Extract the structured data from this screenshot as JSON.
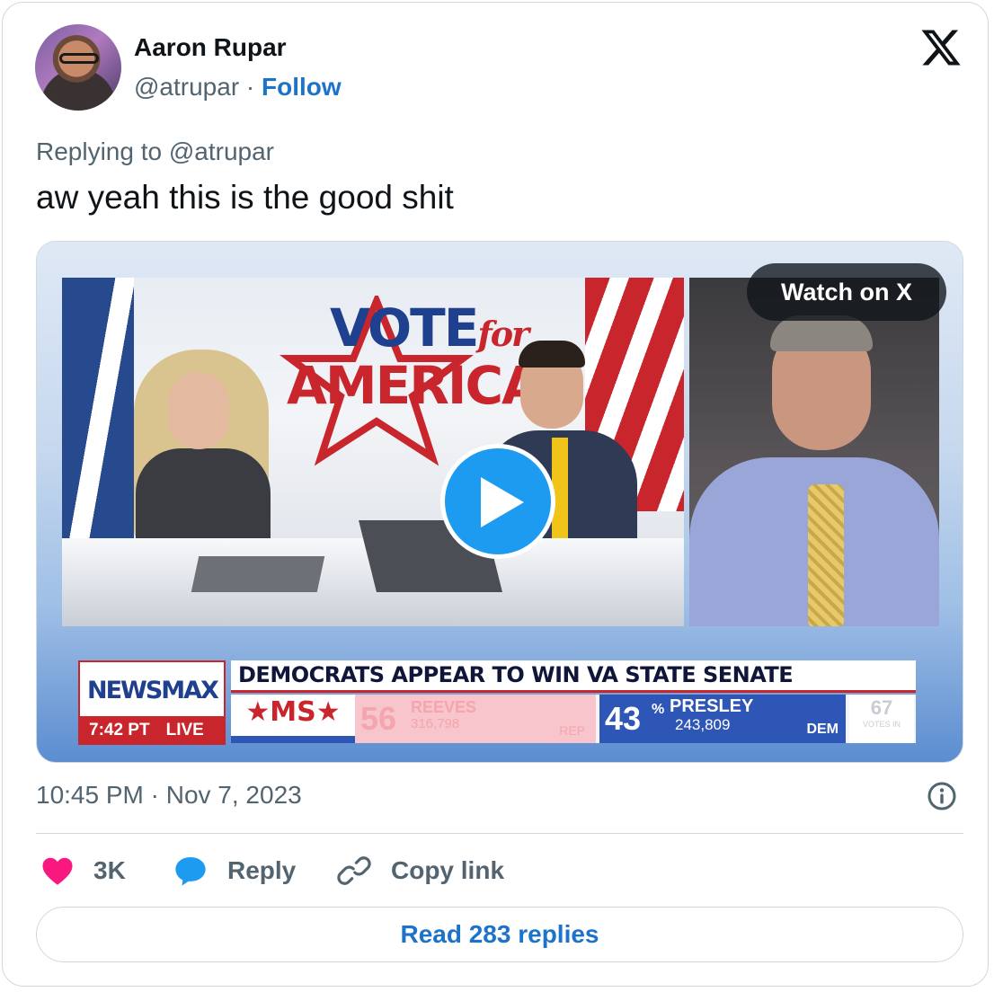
{
  "author": {
    "name": "Aaron Rupar",
    "handle": "@atrupar",
    "separator": "·",
    "follow_label": "Follow"
  },
  "icons": {
    "brand": "x-logo-icon",
    "info": "info-icon",
    "like": "heart-icon",
    "reply": "speech-bubble-icon",
    "copy": "link-icon",
    "play": "play-icon"
  },
  "tweet": {
    "replying_to": "Replying to @atrupar",
    "text": "aw yeah this is the good shit"
  },
  "media": {
    "watch_label": "Watch on X",
    "studio_logo": {
      "line1": "VOTE",
      "line1_suffix": "for",
      "line2": "AMERICA"
    },
    "chyron": {
      "brand": "NEWSMAX",
      "time": "7:42 PT",
      "live": "LIVE",
      "headline": "DEMOCRATS APPEAR TO WIN VA STATE SENATE",
      "state": "★MS★",
      "rep": {
        "pct": "56",
        "pct_sign": "%",
        "name": "REEVES",
        "votes": "316,798",
        "party": "REP"
      },
      "dem": {
        "pct": "43",
        "pct_sign": "%",
        "name": "PRESLEY",
        "votes": "243,809",
        "party": "DEM"
      },
      "votes_in": {
        "number": "67",
        "label": "VOTES IN"
      }
    }
  },
  "timestamp": "10:45 PM · Nov 7, 2023",
  "actions": {
    "like_count": "3K",
    "reply_label": "Reply",
    "copy_label": "Copy link"
  },
  "read_replies_label": "Read 283 replies",
  "colors": {
    "accent_blue": "#1d72c9",
    "like_pink": "#f91880",
    "reply_blue": "#1d9bf0",
    "secondary_text": "#536471",
    "border": "#cfd9de"
  }
}
